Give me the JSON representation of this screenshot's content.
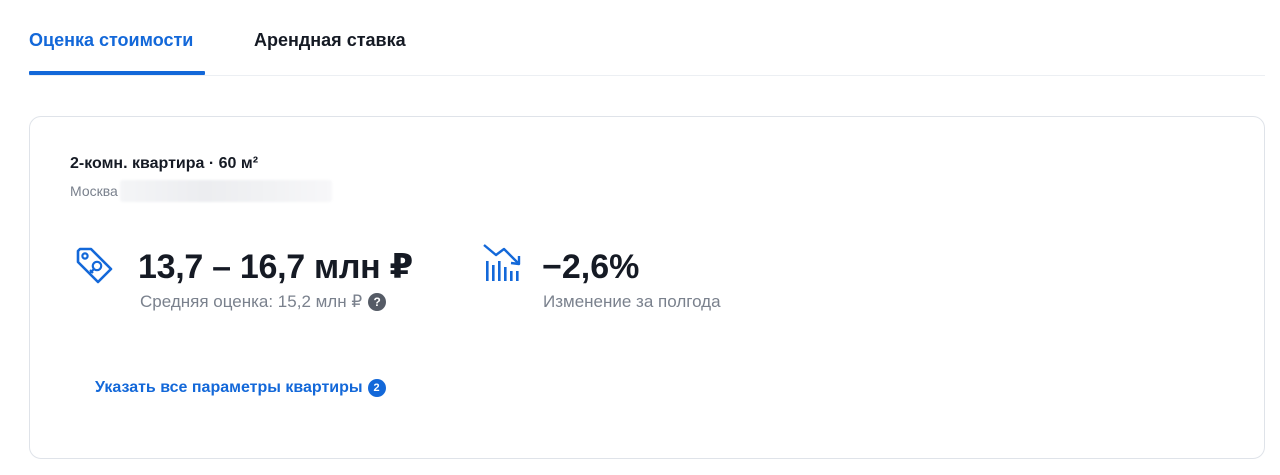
{
  "tabs": [
    {
      "label": "Оценка стоимости",
      "active": true
    },
    {
      "label": "Арендная ставка",
      "active": false
    }
  ],
  "card": {
    "title": "2-комн. квартира · 60 м²",
    "address_city": "Москва",
    "price": {
      "icon": "price-tag-icon",
      "value": "13,7 – 16,7 млн ₽",
      "subtitle": "Средняя оценка: 15,2 млн ₽",
      "help_icon": "?"
    },
    "change": {
      "icon": "trend-down-chart-icon",
      "value": "−2,6%",
      "subtitle": "Изменение за полгода"
    },
    "params_link": {
      "label": "Указать все параметры квартиры",
      "badge": "2"
    }
  },
  "colors": {
    "accent": "#1368d9",
    "text_primary": "#151a24",
    "text_secondary": "#7a818d",
    "border": "#dfe3e9"
  }
}
